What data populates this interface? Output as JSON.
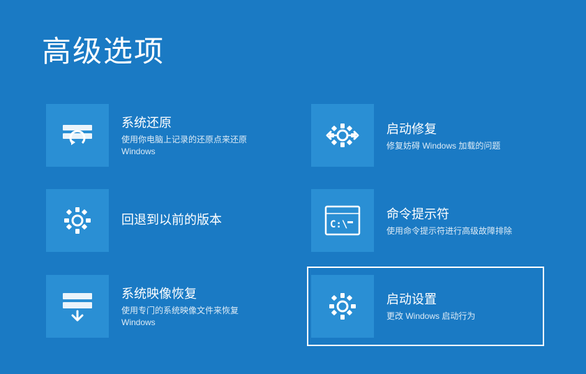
{
  "page": {
    "title": "高级选项",
    "options": [
      {
        "id": "system-restore",
        "title": "系统还原",
        "desc_line1": "使用你电脑上记录的还原点来还原",
        "desc_line2": "Windows",
        "icon": "restore",
        "selected": false,
        "col": 1
      },
      {
        "id": "startup-repair",
        "title": "启动修复",
        "desc_line1": "修复妨碍 Windows 加载的问题",
        "desc_line2": "",
        "icon": "startup-repair",
        "selected": false,
        "col": 2
      },
      {
        "id": "go-back",
        "title": "回退到以前的版本",
        "desc_line1": "",
        "desc_line2": "",
        "icon": "goback",
        "selected": false,
        "col": 1
      },
      {
        "id": "cmd",
        "title": "命令提示符",
        "desc_line1": "使用命令提示符进行高级故障排除",
        "desc_line2": "",
        "icon": "cmd",
        "selected": false,
        "col": 2
      },
      {
        "id": "sys-image",
        "title": "系统映像恢复",
        "desc_line1": "使用专门的系统映像文件来恢复",
        "desc_line2": "Windows",
        "icon": "sysimage",
        "selected": false,
        "col": 1
      },
      {
        "id": "startup-settings",
        "title": "启动设置",
        "desc_line1": "更改 Windows 启动行为",
        "desc_line2": "",
        "icon": "startup-settings",
        "selected": true,
        "col": 2
      }
    ]
  }
}
